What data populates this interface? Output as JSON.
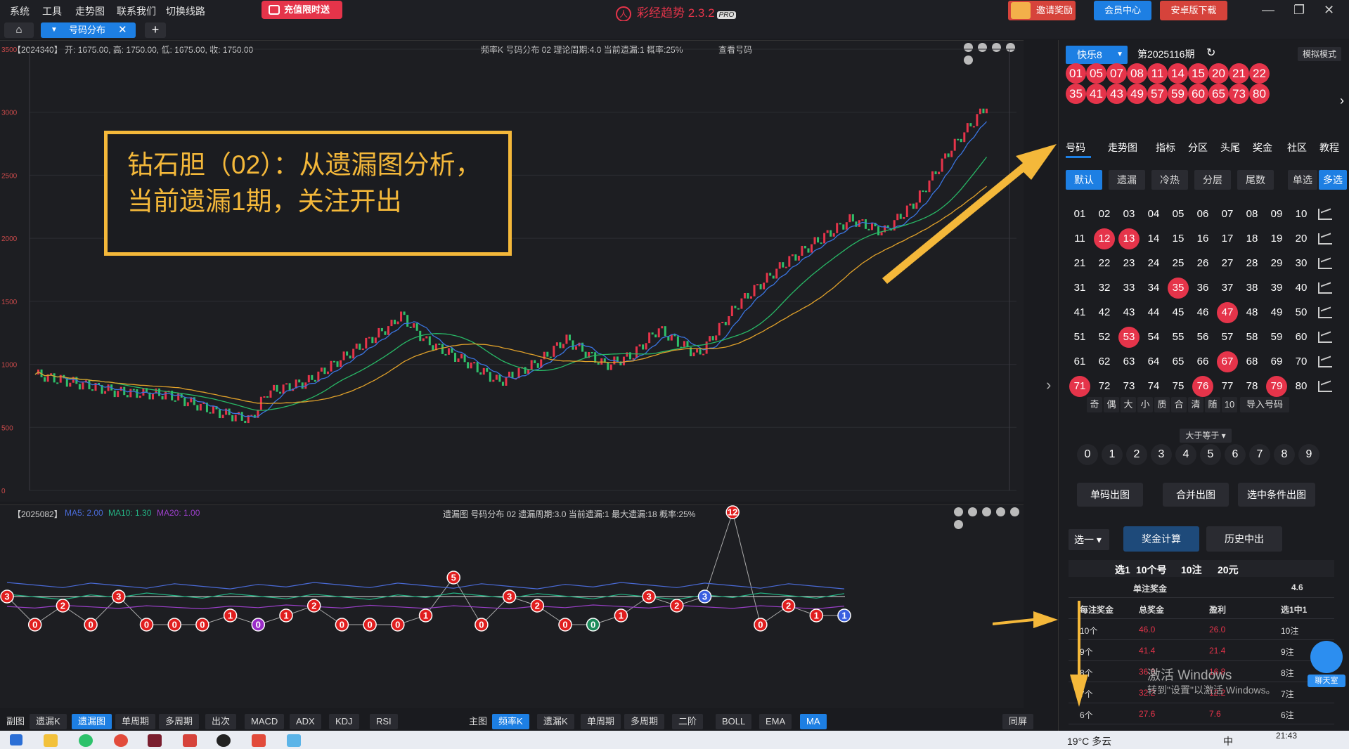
{
  "menu": [
    "系统",
    "工具",
    "走势图",
    "联系我们",
    "切换线路"
  ],
  "recharge_label": "充值限时送",
  "app_title": "彩经趋势 2.3.2",
  "app_badge": "PRO",
  "invite_label": "邀请奖励",
  "member_label": "会员中心",
  "android_label": "安卓版下载",
  "tab_label": "号码分布",
  "main_chart": {
    "info_left": "【2024340】 开: 1675.00, 高: 1750.00, 低: 1675.00, 收: 1750.00",
    "info_center": "频率K  号码分布  02    理论周期:4.0  当前遗漏:1   概率:25%",
    "view_numbers": "查看号码",
    "y_ticks": [
      "3500",
      "3000",
      "2500",
      "2000",
      "1500",
      "1000",
      "500",
      "0"
    ]
  },
  "annotation": {
    "line1": "钻石胆（02）：从遗漏图分析，",
    "line2": "当前遗漏1期，关注开出"
  },
  "sub_chart": {
    "info_left": "【2025082】",
    "ma_labels": [
      "MA5: 2.00",
      "MA10: 1.30",
      "MA20: 1.00"
    ],
    "info_center": "遗漏图  号码分布  02    遗漏周期:3.0  当前遗漏:1   最大遗漏:18   概率:25%",
    "markers": [
      3,
      0,
      2,
      0,
      3,
      0,
      0,
      0,
      1,
      0,
      1,
      2,
      0,
      0,
      0,
      1,
      5,
      0,
      3,
      2,
      0,
      0,
      1,
      3,
      2,
      3,
      12,
      0,
      2,
      1,
      1
    ]
  },
  "bottom_bar": {
    "left_label": "副图",
    "left_buttons": [
      "遗漏K",
      "遗漏图",
      "单周期",
      "多周期",
      "出次",
      "MACD",
      "ADX",
      "KDJ",
      "RSI"
    ],
    "main_label": "主图",
    "main_buttons": [
      "频率K",
      "遗漏K",
      "单周期",
      "多周期",
      "二阶",
      "BOLL",
      "EMA",
      "MA"
    ],
    "sync_label": "同屏"
  },
  "right_panel": {
    "game": "快乐8",
    "issue": "第2025116期",
    "sim_mode": "模拟模式",
    "draw_row1": [
      "01",
      "05",
      "07",
      "08",
      "11",
      "14",
      "15",
      "20",
      "21",
      "22"
    ],
    "draw_row2": [
      "35",
      "41",
      "43",
      "49",
      "57",
      "59",
      "60",
      "65",
      "73",
      "80"
    ],
    "main_tabs": [
      "号码",
      "走势图",
      "指标",
      "分区",
      "头尾",
      "奖金",
      "社区",
      "教程"
    ],
    "sub_tabs": [
      "默认",
      "遗漏",
      "冷热",
      "分层",
      "尾数"
    ],
    "single_label": "单选",
    "multi_label": "多选",
    "selected_numbers": [
      "12",
      "13",
      "35",
      "47",
      "53",
      "67",
      "71",
      "76",
      "79"
    ],
    "filters": [
      "奇",
      "偶",
      "大",
      "小",
      "质",
      "合",
      "清",
      "随",
      "10",
      "导入号码"
    ],
    "gte_label": "大于等于",
    "digits": [
      "0",
      "1",
      "2",
      "3",
      "4",
      "5",
      "6",
      "7",
      "8",
      "9"
    ],
    "out_buttons": [
      "单码出图",
      "合并出图",
      "选中条件出图"
    ],
    "pick_label": "选一",
    "calc_label": "奖金计算",
    "history_label": "历史中出",
    "summary": [
      "选1",
      "10个号",
      "10注",
      "20元"
    ],
    "single_prize_label": "单注奖金",
    "single_prize_value": "4.6",
    "table_headers": [
      "每注奖金",
      "总奖金",
      "盈利",
      "选1中1"
    ],
    "table_rows": [
      [
        "10个",
        "46.0",
        "26.0",
        "10注"
      ],
      [
        "9个",
        "41.4",
        "21.4",
        "9注"
      ],
      [
        "8个",
        "36.8",
        "16.8",
        "8注"
      ],
      [
        "7个",
        "32.2",
        "12.2",
        "7注"
      ],
      [
        "6个",
        "27.6",
        "7.6",
        "6注"
      ]
    ],
    "chat_label": "聊天室",
    "watermark1": "激活 Windows",
    "watermark2": "转到\"设置\"以激活 Windows。"
  },
  "taskbar": {
    "weather": "19°C  多云",
    "ime": "中",
    "time": "21:43"
  },
  "colors": {
    "accent": "#1d7fe3",
    "ball": "#e5344a",
    "annotation": "#f4b83a"
  }
}
